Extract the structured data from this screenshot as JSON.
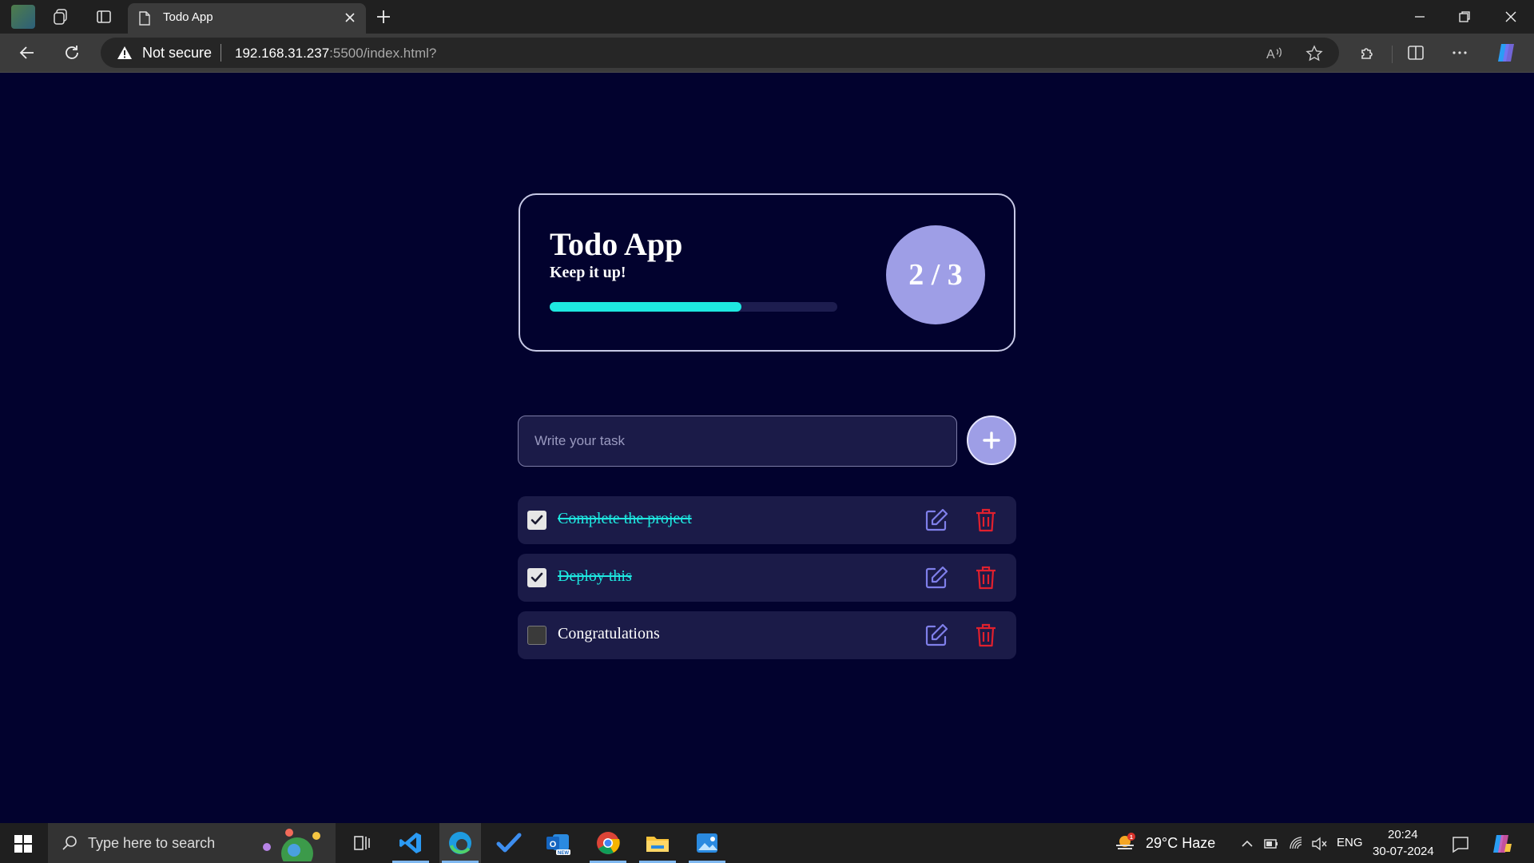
{
  "browser": {
    "tab_title": "Todo App",
    "security_label": "Not secure",
    "url_host": "192.168.31.237",
    "url_rest": ":5500/index.html?"
  },
  "app": {
    "title": "Todo App",
    "subtitle": "Keep it up!",
    "completed": 2,
    "total": 3,
    "counter_text": "2 / 3",
    "progress_fraction": 0.667,
    "input_placeholder": "Write your task",
    "input_value": "",
    "todos": [
      {
        "text": "Complete the project",
        "done": true
      },
      {
        "text": "Deploy this",
        "done": true
      },
      {
        "text": "Congratulations",
        "done": false
      }
    ]
  },
  "colors": {
    "page_bg": "#02022e",
    "accent_cyan": "#1ee8e0",
    "accent_purple": "#9e9ee6",
    "delete_red": "#e0202e",
    "edit_purple": "#7f7fea"
  },
  "taskbar": {
    "search_placeholder": "Type here to search",
    "weather": "29°C  Haze",
    "language": "ENG",
    "time": "20:24",
    "date": "30-07-2024"
  }
}
